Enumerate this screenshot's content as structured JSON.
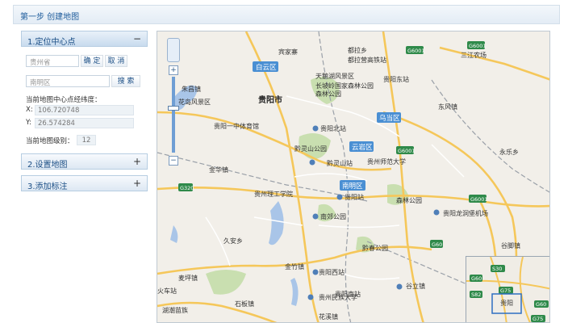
{
  "page": {
    "title": "第一步 创建地图"
  },
  "sidebar": {
    "panel1": {
      "title": "1.定位中心点",
      "toggle": "−",
      "city_value": "贵州省",
      "locate_button": "确 定",
      "cancel_button": "取 消",
      "district_value": "南明区",
      "search_button": "搜 索",
      "coords_label": "当前地图中心点经纬度：",
      "x_label": "X:",
      "x_value": "106.720748",
      "y_label": "Y:",
      "y_value": "26.574284",
      "level_label": "当前地图级别：",
      "level_value": "12"
    },
    "panel2": {
      "title": "2.设置地图",
      "toggle": "+"
    },
    "panel3": {
      "title": "3.添加标注",
      "toggle": "+"
    }
  },
  "map": {
    "districts": [
      "白云区",
      "贵阳市",
      "乌当区",
      "云岩区",
      "南明区"
    ],
    "labels": [
      "宾家寨",
      "都拉乡",
      "都拉营高铁站",
      "天鹅湖风景区",
      "贵阳东站",
      "长坡岭国家森林公园",
      "森林公园",
      "朱昌镇",
      "花岛风景区",
      "贵阳一中体育馆",
      "贵阳北站",
      "东风镇",
      "黔灵山公园",
      "黔灵山站",
      "贵州师范大学",
      "永乐乡",
      "金华镇",
      "贵州理工学院",
      "贵阳站",
      "森林公园",
      "贵阳龙洞堡机场",
      "南郊公园",
      "久安乡",
      "黔春公园",
      "谷脚镇",
      "麦坪镇",
      "金竹镇",
      "贵阳西站",
      "火车站",
      "贵阳南站",
      "谷立镇",
      "贵州民族大学",
      "石板镇",
      "湖潮苗族",
      "花溪镇",
      "三江农场"
    ],
    "shields": [
      "G6001",
      "G6001",
      "G6001",
      "G75",
      "G320",
      "G60",
      "G6001"
    ],
    "minimap": {
      "shields": [
        "S30",
        "G60",
        "S82",
        "G75",
        "G60",
        "G75"
      ],
      "label": "贵阳"
    },
    "zoom_in": "+",
    "zoom_out": "−"
  }
}
